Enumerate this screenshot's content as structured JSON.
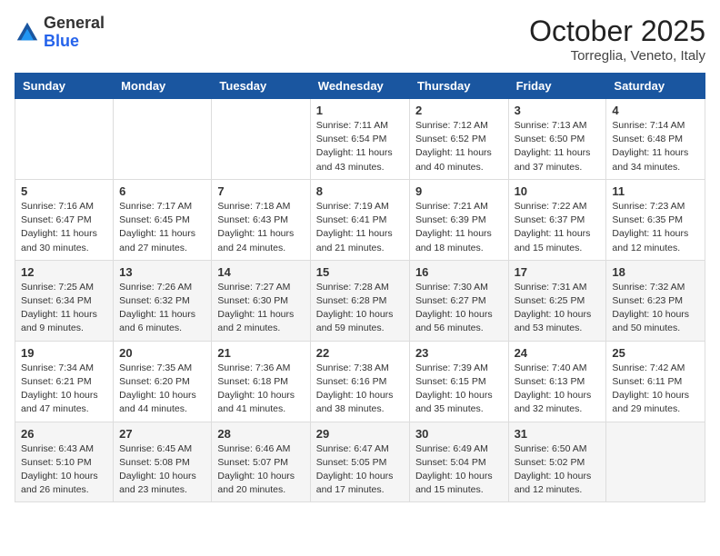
{
  "header": {
    "logo_general": "General",
    "logo_blue": "Blue",
    "month": "October 2025",
    "location": "Torreglia, Veneto, Italy"
  },
  "weekdays": [
    "Sunday",
    "Monday",
    "Tuesday",
    "Wednesday",
    "Thursday",
    "Friday",
    "Saturday"
  ],
  "weeks": [
    [
      {
        "day": "",
        "info": ""
      },
      {
        "day": "",
        "info": ""
      },
      {
        "day": "",
        "info": ""
      },
      {
        "day": "1",
        "info": "Sunrise: 7:11 AM\nSunset: 6:54 PM\nDaylight: 11 hours\nand 43 minutes."
      },
      {
        "day": "2",
        "info": "Sunrise: 7:12 AM\nSunset: 6:52 PM\nDaylight: 11 hours\nand 40 minutes."
      },
      {
        "day": "3",
        "info": "Sunrise: 7:13 AM\nSunset: 6:50 PM\nDaylight: 11 hours\nand 37 minutes."
      },
      {
        "day": "4",
        "info": "Sunrise: 7:14 AM\nSunset: 6:48 PM\nDaylight: 11 hours\nand 34 minutes."
      }
    ],
    [
      {
        "day": "5",
        "info": "Sunrise: 7:16 AM\nSunset: 6:47 PM\nDaylight: 11 hours\nand 30 minutes."
      },
      {
        "day": "6",
        "info": "Sunrise: 7:17 AM\nSunset: 6:45 PM\nDaylight: 11 hours\nand 27 minutes."
      },
      {
        "day": "7",
        "info": "Sunrise: 7:18 AM\nSunset: 6:43 PM\nDaylight: 11 hours\nand 24 minutes."
      },
      {
        "day": "8",
        "info": "Sunrise: 7:19 AM\nSunset: 6:41 PM\nDaylight: 11 hours\nand 21 minutes."
      },
      {
        "day": "9",
        "info": "Sunrise: 7:21 AM\nSunset: 6:39 PM\nDaylight: 11 hours\nand 18 minutes."
      },
      {
        "day": "10",
        "info": "Sunrise: 7:22 AM\nSunset: 6:37 PM\nDaylight: 11 hours\nand 15 minutes."
      },
      {
        "day": "11",
        "info": "Sunrise: 7:23 AM\nSunset: 6:35 PM\nDaylight: 11 hours\nand 12 minutes."
      }
    ],
    [
      {
        "day": "12",
        "info": "Sunrise: 7:25 AM\nSunset: 6:34 PM\nDaylight: 11 hours\nand 9 minutes."
      },
      {
        "day": "13",
        "info": "Sunrise: 7:26 AM\nSunset: 6:32 PM\nDaylight: 11 hours\nand 6 minutes."
      },
      {
        "day": "14",
        "info": "Sunrise: 7:27 AM\nSunset: 6:30 PM\nDaylight: 11 hours\nand 2 minutes."
      },
      {
        "day": "15",
        "info": "Sunrise: 7:28 AM\nSunset: 6:28 PM\nDaylight: 10 hours\nand 59 minutes."
      },
      {
        "day": "16",
        "info": "Sunrise: 7:30 AM\nSunset: 6:27 PM\nDaylight: 10 hours\nand 56 minutes."
      },
      {
        "day": "17",
        "info": "Sunrise: 7:31 AM\nSunset: 6:25 PM\nDaylight: 10 hours\nand 53 minutes."
      },
      {
        "day": "18",
        "info": "Sunrise: 7:32 AM\nSunset: 6:23 PM\nDaylight: 10 hours\nand 50 minutes."
      }
    ],
    [
      {
        "day": "19",
        "info": "Sunrise: 7:34 AM\nSunset: 6:21 PM\nDaylight: 10 hours\nand 47 minutes."
      },
      {
        "day": "20",
        "info": "Sunrise: 7:35 AM\nSunset: 6:20 PM\nDaylight: 10 hours\nand 44 minutes."
      },
      {
        "day": "21",
        "info": "Sunrise: 7:36 AM\nSunset: 6:18 PM\nDaylight: 10 hours\nand 41 minutes."
      },
      {
        "day": "22",
        "info": "Sunrise: 7:38 AM\nSunset: 6:16 PM\nDaylight: 10 hours\nand 38 minutes."
      },
      {
        "day": "23",
        "info": "Sunrise: 7:39 AM\nSunset: 6:15 PM\nDaylight: 10 hours\nand 35 minutes."
      },
      {
        "day": "24",
        "info": "Sunrise: 7:40 AM\nSunset: 6:13 PM\nDaylight: 10 hours\nand 32 minutes."
      },
      {
        "day": "25",
        "info": "Sunrise: 7:42 AM\nSunset: 6:11 PM\nDaylight: 10 hours\nand 29 minutes."
      }
    ],
    [
      {
        "day": "26",
        "info": "Sunrise: 6:43 AM\nSunset: 5:10 PM\nDaylight: 10 hours\nand 26 minutes."
      },
      {
        "day": "27",
        "info": "Sunrise: 6:45 AM\nSunset: 5:08 PM\nDaylight: 10 hours\nand 23 minutes."
      },
      {
        "day": "28",
        "info": "Sunrise: 6:46 AM\nSunset: 5:07 PM\nDaylight: 10 hours\nand 20 minutes."
      },
      {
        "day": "29",
        "info": "Sunrise: 6:47 AM\nSunset: 5:05 PM\nDaylight: 10 hours\nand 17 minutes."
      },
      {
        "day": "30",
        "info": "Sunrise: 6:49 AM\nSunset: 5:04 PM\nDaylight: 10 hours\nand 15 minutes."
      },
      {
        "day": "31",
        "info": "Sunrise: 6:50 AM\nSunset: 5:02 PM\nDaylight: 10 hours\nand 12 minutes."
      },
      {
        "day": "",
        "info": ""
      }
    ]
  ]
}
